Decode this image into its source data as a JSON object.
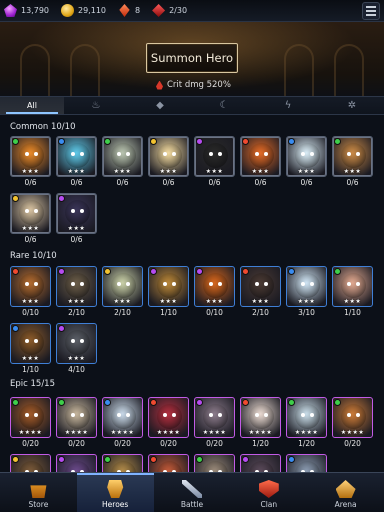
{
  "resources": {
    "gems": "13,790",
    "gold": "29,110",
    "shards": "8",
    "tickets": "2/30"
  },
  "header": {
    "summon_label": "Summon Hero",
    "bonus_text": "Crit dmg 520%"
  },
  "filters": [
    {
      "label": "All",
      "icon": "all"
    },
    {
      "label": "",
      "icon": "fire-icon"
    },
    {
      "label": "",
      "icon": "water-icon"
    },
    {
      "label": "",
      "icon": "moon-icon"
    },
    {
      "label": "",
      "icon": "lightning-icon"
    },
    {
      "label": "",
      "icon": "gear-icon"
    }
  ],
  "sections": [
    {
      "title": "Common 10/10",
      "rarity": "common",
      "heroes": [
        {
          "count": "0/6",
          "stars": "★★★",
          "element": "#3ecf4a",
          "color": "#e8892a"
        },
        {
          "count": "0/6",
          "stars": "★★★",
          "element": "#3a8cf0",
          "color": "#5fc8e8"
        },
        {
          "count": "0/6",
          "stars": "★★★",
          "element": "#3ecf4a",
          "color": "#b9c4b0"
        },
        {
          "count": "0/6",
          "stars": "★★★",
          "element": "#f2c230",
          "color": "#f1d9a0"
        },
        {
          "count": "0/6",
          "stars": "★★★",
          "element": "#b64bf0",
          "color": "#2a2a2a"
        },
        {
          "count": "0/6",
          "stars": "★★★",
          "element": "#f04a30",
          "color": "#e06a28"
        },
        {
          "count": "0/6",
          "stars": "★★★",
          "element": "#3a8cf0",
          "color": "#d9ecf6"
        },
        {
          "count": "0/6",
          "stars": "★★★",
          "element": "#3ecf4a",
          "color": "#c98a48"
        },
        {
          "count": "0/6",
          "stars": "★★★",
          "element": "#f2c230",
          "color": "#d6c1a0"
        },
        {
          "count": "0/6",
          "stars": "★★★",
          "element": "#b64bf0",
          "color": "#3a3558"
        }
      ]
    },
    {
      "title": "Rare 10/10",
      "rarity": "rare",
      "heroes": [
        {
          "count": "0/10",
          "stars": "★★★",
          "element": "#f04a30",
          "color": "#b06a30"
        },
        {
          "count": "2/10",
          "stars": "★★★",
          "element": "#b64bf0",
          "color": "#6a5c48"
        },
        {
          "count": "2/10",
          "stars": "★★★",
          "element": "#f2c230",
          "color": "#c9d0a8"
        },
        {
          "count": "1/10",
          "stars": "★★★",
          "element": "#b64bf0",
          "color": "#b8863a"
        },
        {
          "count": "0/10",
          "stars": "★★★",
          "element": "#b64bf0",
          "color": "#d4661e"
        },
        {
          "count": "2/10",
          "stars": "★★★",
          "element": "#f04a30",
          "color": "#4a3a34"
        },
        {
          "count": "3/10",
          "stars": "★★★",
          "element": "#3a8cf0",
          "color": "#cfe4f4"
        },
        {
          "count": "1/10",
          "stars": "★★★",
          "element": "#3ecf4a",
          "color": "#e0a890"
        },
        {
          "count": "1/10",
          "stars": "★★★",
          "element": "#3a8cf0",
          "color": "#8a5a2a"
        },
        {
          "count": "4/10",
          "stars": "★★★",
          "element": "#b64bf0",
          "color": "#5a5e66"
        }
      ]
    },
    {
      "title": "Epic 15/15",
      "rarity": "epic",
      "heroes": [
        {
          "count": "0/20",
          "stars": "★★★★",
          "element": "#3ecf4a",
          "color": "#a05a2a"
        },
        {
          "count": "0/20",
          "stars": "★★★★",
          "element": "#3ecf4a",
          "color": "#c4b49c"
        },
        {
          "count": "0/20",
          "stars": "★★★★",
          "element": "#3a8cf0",
          "color": "#c8d8e8"
        },
        {
          "count": "0/20",
          "stars": "★★★★",
          "element": "#f04a30",
          "color": "#b03040"
        },
        {
          "count": "0/20",
          "stars": "★★★★",
          "element": "#b64bf0",
          "color": "#8a7a8a"
        },
        {
          "count": "1/20",
          "stars": "★★★★",
          "element": "#f04a30",
          "color": "#e8d8d0"
        },
        {
          "count": "1/20",
          "stars": "★★★★",
          "element": "#3ecf4a",
          "color": "#c8dce8"
        },
        {
          "count": "0/20",
          "stars": "★★★★",
          "element": "#3ecf4a",
          "color": "#c87a3a"
        },
        {
          "count": "",
          "stars": "",
          "element": "#f2c230",
          "color": "#7a5a3a"
        },
        {
          "count": "",
          "stars": "",
          "element": "#b64bf0",
          "color": "#6a4a8a"
        },
        {
          "count": "",
          "stars": "",
          "element": "#3ecf4a",
          "color": "#b08a4a"
        },
        {
          "count": "",
          "stars": "",
          "element": "#f04a30",
          "color": "#c05a3a"
        },
        {
          "count": "",
          "stars": "",
          "element": "#3ecf4a",
          "color": "#9a8a7a"
        },
        {
          "count": "",
          "stars": "",
          "element": "#b64bf0",
          "color": "#5a4a5a"
        },
        {
          "count": "",
          "stars": "",
          "element": "#3a8cf0",
          "color": "#8a9ab0"
        }
      ]
    }
  ],
  "nav": [
    {
      "label": "Store",
      "icon": "store-icon"
    },
    {
      "label": "Heroes",
      "icon": "heroes-icon"
    },
    {
      "label": "Battle",
      "icon": "battle-icon"
    },
    {
      "label": "Clan",
      "icon": "clan-icon"
    },
    {
      "label": "Arena",
      "icon": "arena-icon"
    }
  ]
}
